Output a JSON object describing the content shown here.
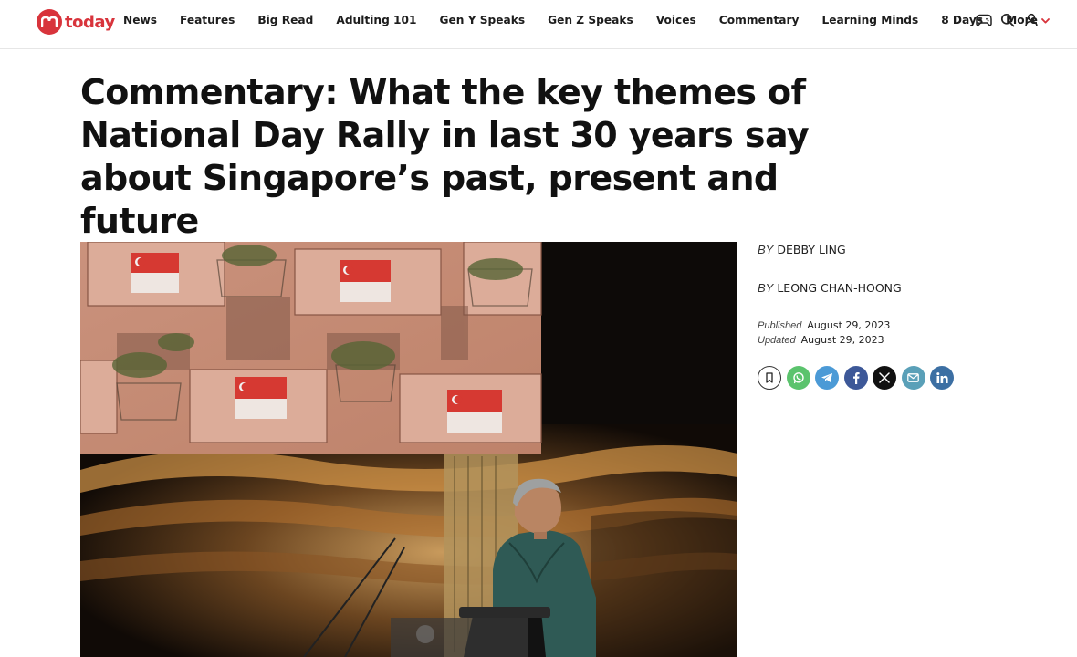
{
  "brand": {
    "name": "today",
    "accent": "#d8343c"
  },
  "nav": {
    "items": [
      {
        "label": "News"
      },
      {
        "label": "Features"
      },
      {
        "label": "Big Read"
      },
      {
        "label": "Adulting 101"
      },
      {
        "label": "Gen Y Speaks"
      },
      {
        "label": "Gen Z Speaks"
      },
      {
        "label": "Voices"
      },
      {
        "label": "Commentary"
      },
      {
        "label": "Learning Minds"
      },
      {
        "label": "8 Days"
      }
    ],
    "more_label": "More",
    "icons": [
      "gamepad-icon",
      "search-icon",
      "user-icon"
    ]
  },
  "article": {
    "headline": "Commentary: What the key themes of National Day Rally in last 30 years say about Singapore’s past, present and future",
    "hero_image": "photo-speaker-at-podium-with-flags-backdrop",
    "authors": [
      {
        "by": "BY",
        "name": "Debby Ling"
      },
      {
        "by": "BY",
        "name": "Leong Chan-Hoong"
      }
    ],
    "published_label": "Published",
    "published_date": "August 29, 2023",
    "updated_label": "Updated",
    "updated_date": "August 29, 2023",
    "share_icons": [
      "bookmark-icon",
      "whatsapp-icon",
      "telegram-icon",
      "facebook-icon",
      "x-icon",
      "email-icon",
      "linkedin-icon"
    ]
  }
}
